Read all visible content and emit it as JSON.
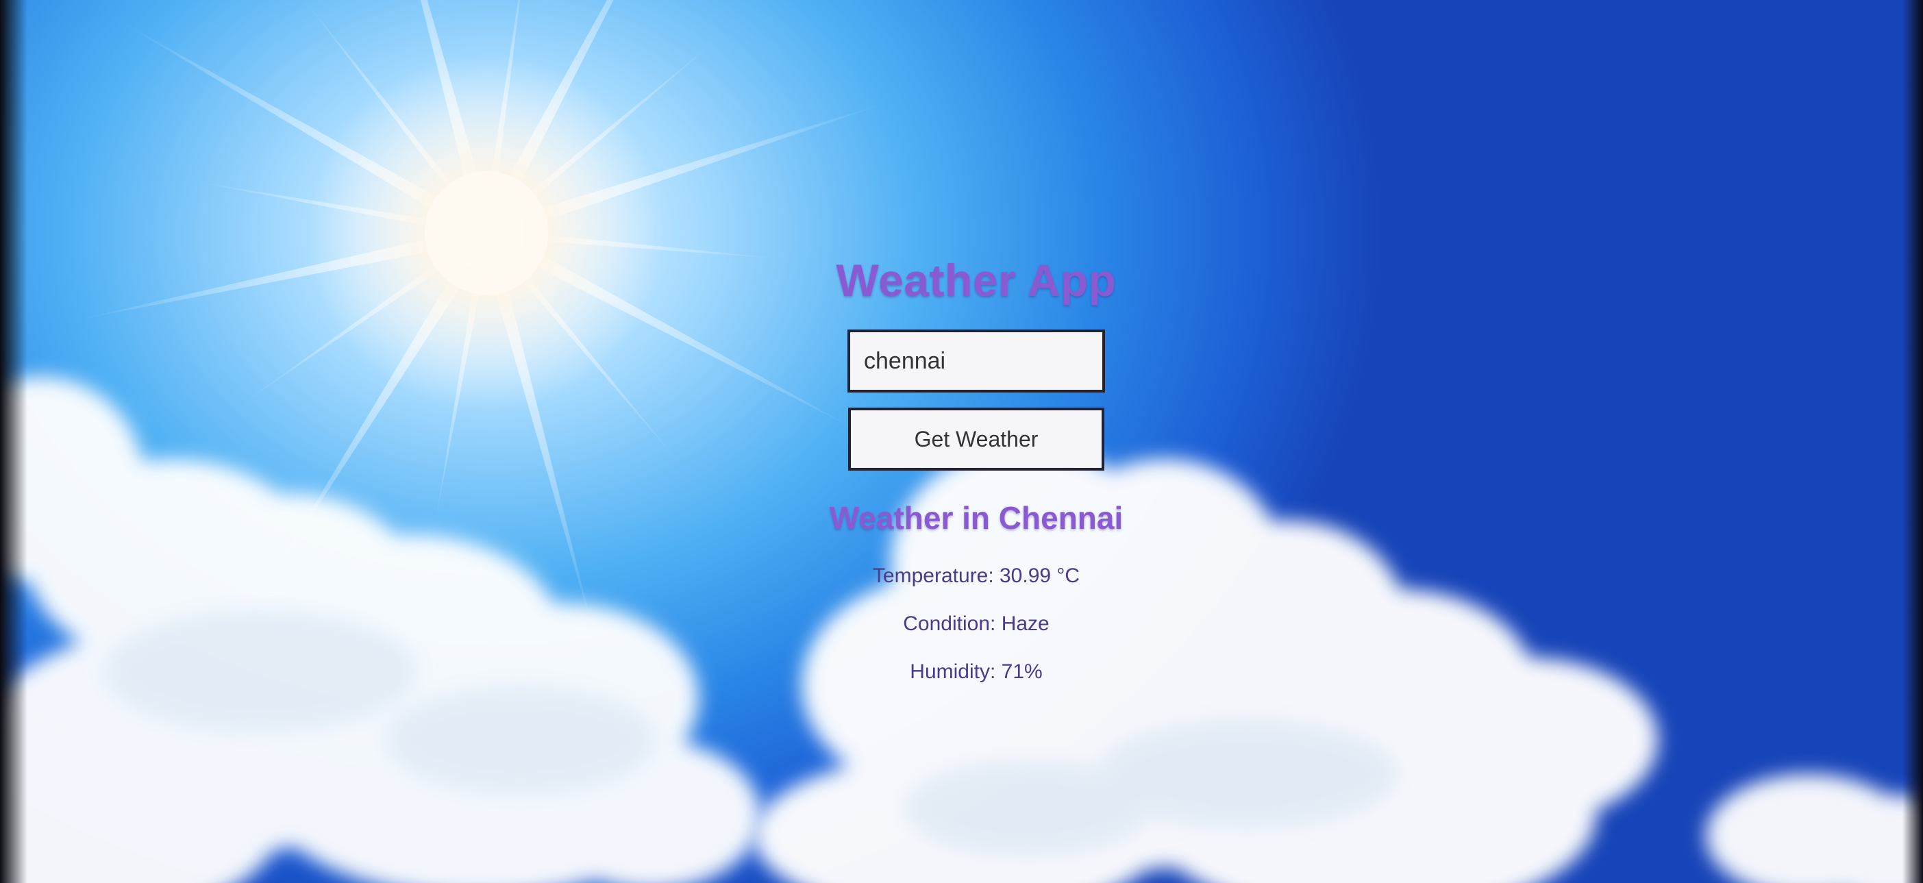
{
  "app": {
    "title": "Weather App"
  },
  "search": {
    "value": "chennai"
  },
  "actions": {
    "get_weather_label": "Get Weather"
  },
  "result": {
    "heading": "Weather in Chennai",
    "details": [
      {
        "label": "Temperature:",
        "value": "30.99 °C"
      },
      {
        "label": "Condition:",
        "value": "Haze"
      },
      {
        "label": "Humidity:",
        "value": "71%"
      }
    ]
  },
  "colors": {
    "title": "#8a5ad2",
    "detail_text": "#4a3a8c",
    "sky_light": "#a9dcff",
    "sky_dark": "#1744b8"
  }
}
